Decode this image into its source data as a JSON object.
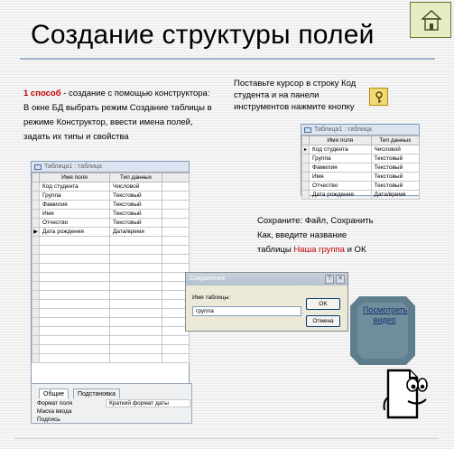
{
  "slide": {
    "title": "Создание структуры полей",
    "left_instruction": {
      "method": "1 способ",
      "text": " - создание с помощью конструктора: В окне БД выбрать режим Создание таблицы в режиме Конструктор, ввести имена полей, задать их типы и свойства"
    },
    "right_instruction": "Поставьте курсор в строку Код студента и на панели инструментов нажмите кнопку",
    "save_instruction": {
      "before": "Сохраните: Файл, Сохранить Как, введите название таблицы ",
      "table_name": "Наша группа",
      "after": " и ОК"
    },
    "video_link": "Посмотреть видео"
  },
  "design_window": {
    "title": "Таблица1 : таблица",
    "columns": [
      "Имя поля",
      "Тип данных"
    ],
    "rows": [
      [
        "Код студента",
        "Числовой"
      ],
      [
        "Группа",
        "Текстовый"
      ],
      [
        "Фамилия",
        "Текстовый"
      ],
      [
        "Имя",
        "Текстовый"
      ],
      [
        "Отчество",
        "Текстовый"
      ],
      [
        "Дата рождения",
        "Дата/время"
      ]
    ],
    "tabs": [
      "Общие",
      "Подстановка"
    ],
    "props": [
      "Формат поля",
      "Маска ввода",
      "Подпись"
    ],
    "format_value": "Краткий формат даты"
  },
  "key_window": {
    "title": "Таблица1 : таблица",
    "columns": [
      "Имя поля",
      "Тип данных"
    ],
    "rows": [
      [
        "Код студента",
        "Числовой"
      ],
      [
        "Группа",
        "Текстовый"
      ],
      [
        "Фамилия",
        "Текстовый"
      ],
      [
        "Имя",
        "Текстовый"
      ],
      [
        "Отчество",
        "Текстовый"
      ],
      [
        "Дата рождения",
        "Дата/время"
      ]
    ]
  },
  "save_dialog": {
    "title": "Сохранение",
    "label": "Имя таблицы:",
    "value": "группа",
    "ok": "OK",
    "cancel": "Отмена"
  }
}
